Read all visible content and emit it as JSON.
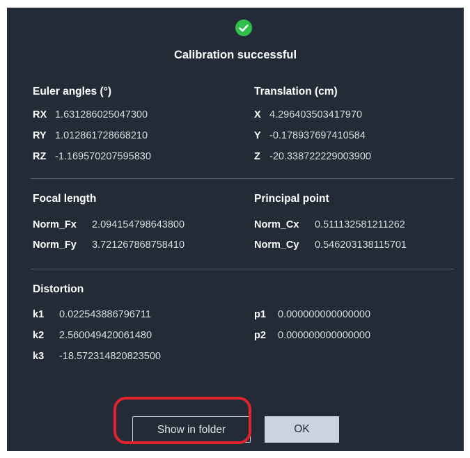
{
  "dialog": {
    "title": "Calibration successful",
    "status_icon": "success-check-icon",
    "colors": {
      "background": "#232c36",
      "success": "#2fbf4a",
      "highlight": "#e0232f",
      "ok_button": "#c9d4df"
    }
  },
  "euler": {
    "heading": "Euler angles (°)",
    "rows": [
      {
        "label": "RX",
        "value": "1.631286025047300"
      },
      {
        "label": "RY",
        "value": "1.012861728668210"
      },
      {
        "label": "RZ",
        "value": "-1.169570207595830"
      }
    ]
  },
  "translation": {
    "heading": "Translation (cm)",
    "rows": [
      {
        "label": "X",
        "value": "4.296403503417970"
      },
      {
        "label": "Y",
        "value": "-0.178937697410584"
      },
      {
        "label": "Z",
        "value": "-20.338722229003900"
      }
    ]
  },
  "focal": {
    "heading": "Focal length",
    "rows": [
      {
        "label": "Norm_Fx",
        "value": "2.094154798643800"
      },
      {
        "label": "Norm_Fy",
        "value": "3.721267868758410"
      }
    ]
  },
  "principal": {
    "heading": "Principal point",
    "rows": [
      {
        "label": "Norm_Cx",
        "value": "0.511132581211262"
      },
      {
        "label": "Norm_Cy",
        "value": "0.546203138115701"
      }
    ]
  },
  "distortion": {
    "heading": "Distortion",
    "k_rows": [
      {
        "label": "k1",
        "value": "0.022543886796711"
      },
      {
        "label": "k2",
        "value": "2.560049420061480"
      },
      {
        "label": "k3",
        "value": "-18.572314820823500"
      }
    ],
    "p_rows": [
      {
        "label": "p1",
        "value": "0.000000000000000"
      },
      {
        "label": "p2",
        "value": "0.000000000000000"
      }
    ]
  },
  "buttons": {
    "show_in_folder": "Show in folder",
    "ok": "OK"
  }
}
